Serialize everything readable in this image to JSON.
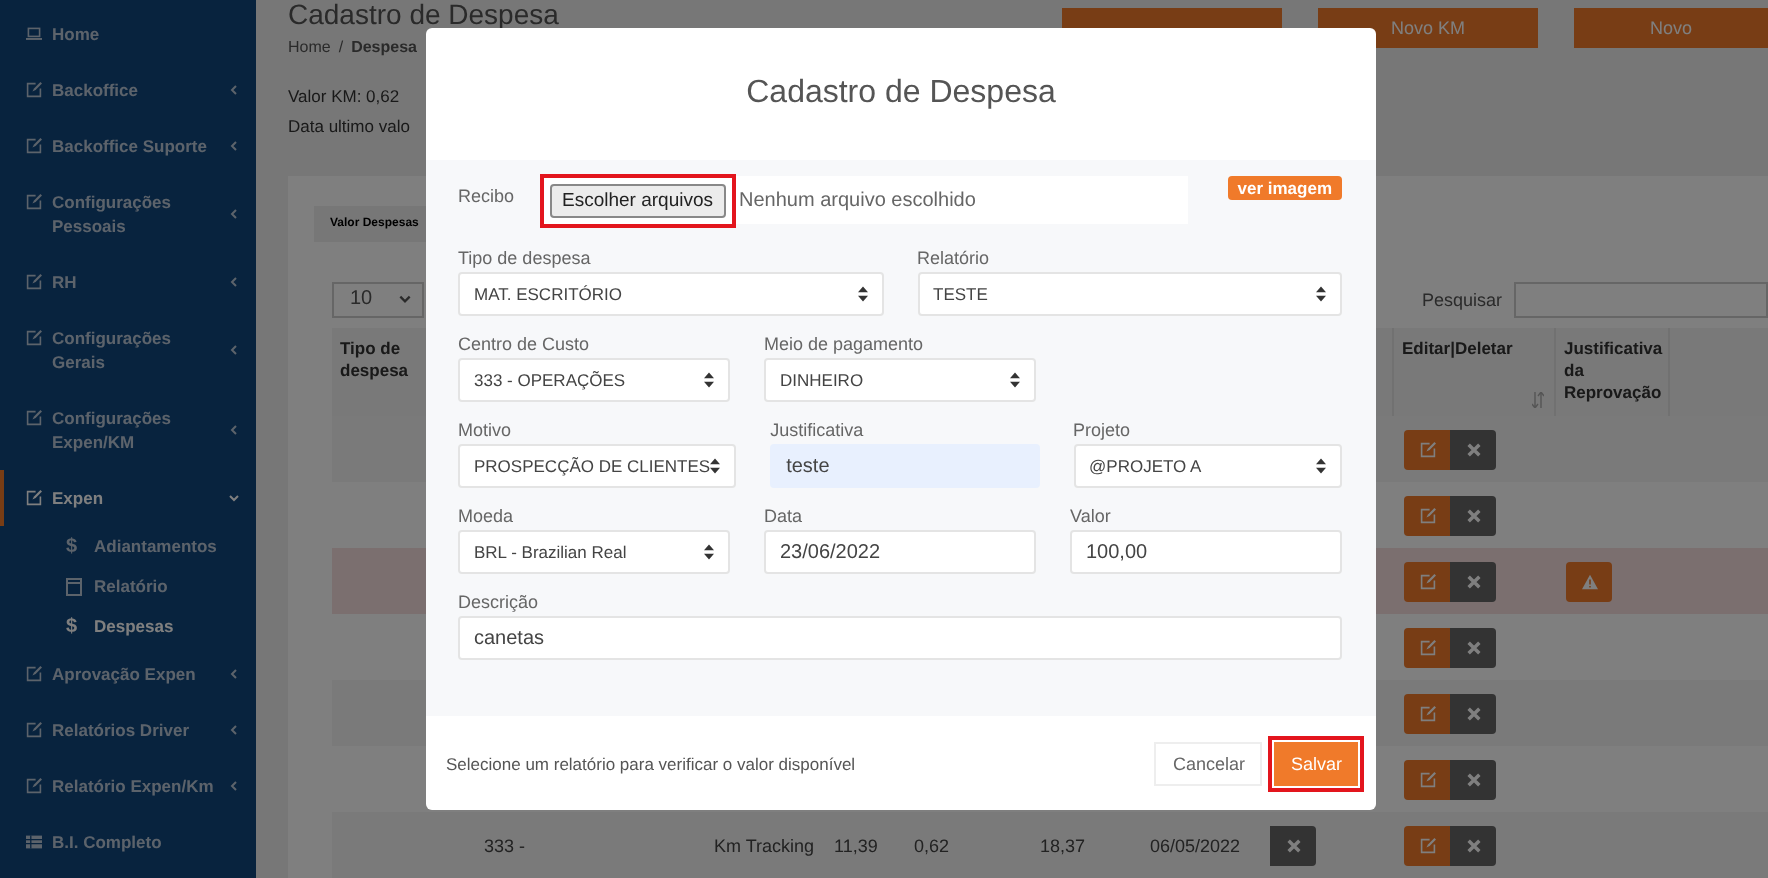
{
  "sidebar": {
    "items": [
      {
        "label": "Home",
        "kind": "laptop",
        "expanded": false,
        "has_children": false
      },
      {
        "label": "Backoffice",
        "kind": "edit",
        "expanded": false,
        "has_children": true
      },
      {
        "label": "Backoffice Suporte",
        "kind": "edit",
        "expanded": false,
        "has_children": true
      },
      {
        "label": "Configurações Pessoais",
        "kind": "edit",
        "expanded": false,
        "has_children": true
      },
      {
        "label": "RH",
        "kind": "edit",
        "expanded": false,
        "has_children": true
      },
      {
        "label": "Configurações Gerais",
        "kind": "edit",
        "expanded": false,
        "has_children": true
      },
      {
        "label": "Configurações Expen/KM",
        "kind": "edit",
        "expanded": false,
        "has_children": true
      },
      {
        "label": "Expen",
        "kind": "edit",
        "expanded": true,
        "has_children": true,
        "children": [
          {
            "label": "Adiantamentos",
            "kind": "glyph",
            "glyph": "$",
            "selected": false
          },
          {
            "label": "Relatório",
            "kind": "doc",
            "selected": false
          },
          {
            "label": "Despesas",
            "kind": "glyph",
            "glyph": "$",
            "selected": true
          }
        ]
      },
      {
        "label": "Aprovação Expen",
        "kind": "edit",
        "expanded": false,
        "has_children": true
      },
      {
        "label": "Relatórios Driver",
        "kind": "edit",
        "expanded": false,
        "has_children": true
      },
      {
        "label": "Relatório Expen/Km",
        "kind": "edit",
        "expanded": false,
        "has_children": true
      },
      {
        "label": "B.I. Completo",
        "kind": "grid",
        "expanded": false,
        "has_children": false
      }
    ]
  },
  "page": {
    "title": "Cadastro de Despesa",
    "breadcrumb": [
      "Home",
      "Despesa"
    ],
    "breadcrumb_separator": "/",
    "info": [
      "Valor KM: 0,62",
      "Data ultimo valo"
    ],
    "header_buttons": [
      {
        "kind": "blank"
      },
      {
        "kind": "text",
        "label": "Novo KM"
      },
      {
        "kind": "text",
        "label": "Novo"
      }
    ],
    "tab": "Valor Despesas",
    "page_size": "10",
    "search_label": "Pesquisar"
  },
  "table": {
    "columns": [
      "Tipo de despesa",
      "",
      "",
      "",
      "",
      "",
      "",
      "",
      "",
      "Editar|Deletar",
      "Justificativa da Reprovação"
    ],
    "rows": [
      {
        "rejected": false
      },
      {
        "rejected": false
      },
      {
        "rejected": true
      },
      {
        "rejected": false
      },
      {
        "rejected": false
      },
      {
        "rejected": false
      },
      {
        "rejected": false,
        "cells": [
          "",
          "333 -",
          "",
          "Km Tracking",
          "11,39",
          "0,62",
          "18,37",
          "06/05/2022"
        ]
      }
    ]
  },
  "modal": {
    "title": "Cadastro de Despesa",
    "receipt": {
      "label": "Recibo",
      "button": "Escolher arquivos",
      "status": "Nenhum arquivo escolhido",
      "annotated": true,
      "badge": "ver imagem"
    },
    "rows": [
      [
        {
          "label": "Tipo de despesa",
          "value": "MAT. ESCRITÓRIO",
          "kind": "select",
          "autofill": false
        },
        {
          "label": "Relatório",
          "value": "TESTE",
          "kind": "select",
          "autofill": false
        }
      ],
      [
        {
          "label": "Centro de Custo",
          "value": "333 - OPERAÇÕES",
          "kind": "select",
          "autofill": false
        },
        {
          "label": "Meio de pagamento",
          "value": "DINHEIRO",
          "kind": "select",
          "autofill": false
        }
      ],
      [
        {
          "label": "Motivo",
          "value": "PROSPECÇÃO DE CLIENTES",
          "kind": "select",
          "autofill": false
        },
        {
          "label": "Justificativa",
          "value": "teste",
          "kind": "text",
          "autofill": true
        },
        {
          "label": "Projeto",
          "value": "@PROJETO A",
          "kind": "select",
          "autofill": false
        }
      ],
      [
        {
          "label": "Moeda",
          "value": "BRL - Brazilian Real",
          "kind": "select",
          "autofill": false
        },
        {
          "label": "Data",
          "value": "23/06/2022",
          "kind": "text",
          "autofill": false
        },
        {
          "label": "Valor",
          "value": "100,00",
          "kind": "text",
          "autofill": false
        }
      ],
      [
        {
          "label": "Descrição",
          "value": "canetas",
          "kind": "text",
          "autofill": false
        }
      ]
    ],
    "footer_note": "Selecione um relatório para verificar o valor disponível",
    "buttons": [
      {
        "label": "Cancelar",
        "kind": "secondary",
        "annotated": false
      },
      {
        "label": "Salvar",
        "kind": "primary",
        "annotated": true
      }
    ]
  }
}
